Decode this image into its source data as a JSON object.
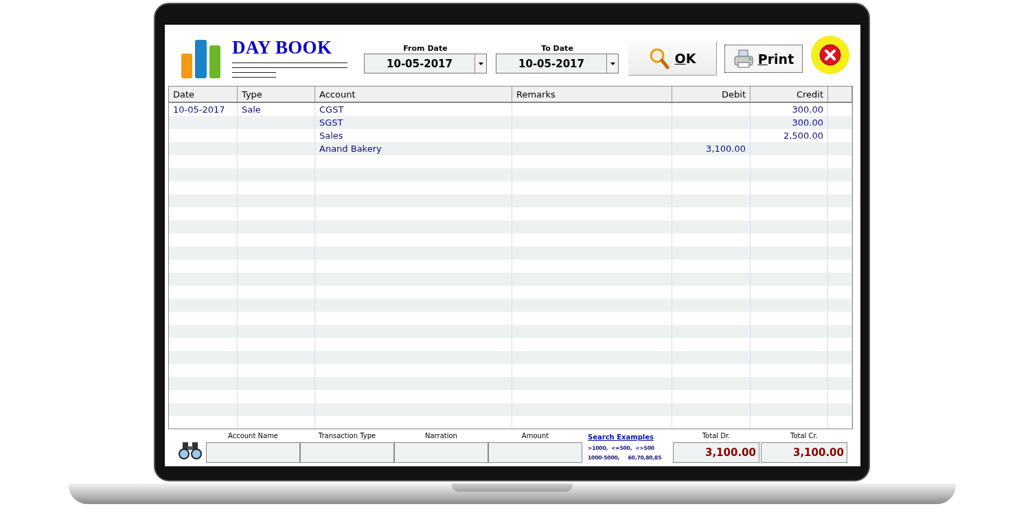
{
  "title": "DAY BOOK",
  "date_filters": [
    {
      "label": "From Date",
      "value": "10-05-2017"
    },
    {
      "label": "To Date",
      "value": "10-05-2017"
    }
  ],
  "buttons": [
    {
      "kind": "ok",
      "label": "OK"
    },
    {
      "kind": "print",
      "label": "Print"
    },
    {
      "kind": "close"
    }
  ],
  "table": {
    "columns": [
      "Date",
      "Type",
      "Account",
      "Remarks",
      "Debit",
      "Credit"
    ],
    "rows": [
      {
        "date": "10-05-2017",
        "type": "Sale",
        "account": "CGST",
        "credit": "300.00"
      },
      {
        "account": "SGST",
        "credit": "300.00"
      },
      {
        "account": "Sales",
        "credit": "2,500.00"
      },
      {
        "account": "Anand Bakery",
        "debit": "3,100.00"
      }
    ]
  },
  "search_fields": [
    {
      "label": "Account Name"
    },
    {
      "label": "Transaction Type"
    },
    {
      "label": "Narration"
    },
    {
      "label": "Amount"
    }
  ],
  "search_examples": {
    "link": "Search Examples",
    "lines": [
      ">1000,  <=500,  <>500",
      "1000-5000,     60,70,80,85"
    ]
  },
  "totals": [
    {
      "label": "Total Dr.",
      "value": "3,100.00"
    },
    {
      "label": "Total Cr.",
      "value": "3,100.00"
    }
  ]
}
